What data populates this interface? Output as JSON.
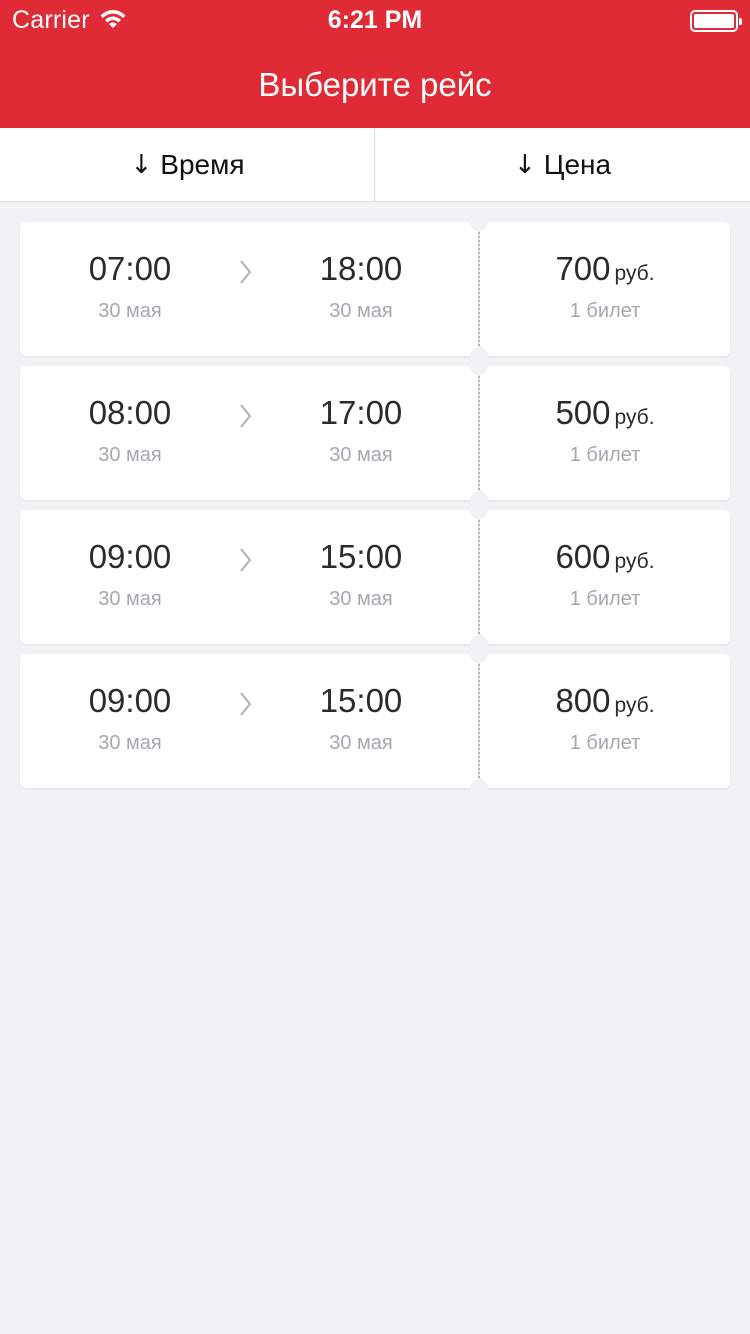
{
  "status_bar": {
    "carrier": "Carrier",
    "time": "6:21 PM"
  },
  "header": {
    "title": "Выберите рейс",
    "color": "#e02b36"
  },
  "sort": {
    "time_label": "Время",
    "price_label": "Цена",
    "arrow_icon": "arrow-down-icon"
  },
  "trips": [
    {
      "dep_time": "07:00",
      "dep_date": "30 мая",
      "arr_time": "18:00",
      "arr_date": "30 мая",
      "price": "700",
      "currency": "руб.",
      "tickets": "1 билет"
    },
    {
      "dep_time": "08:00",
      "dep_date": "30 мая",
      "arr_time": "17:00",
      "arr_date": "30 мая",
      "price": "500",
      "currency": "руб.",
      "tickets": "1 билет"
    },
    {
      "dep_time": "09:00",
      "dep_date": "30 мая",
      "arr_time": "15:00",
      "arr_date": "30 мая",
      "price": "600",
      "currency": "руб.",
      "tickets": "1 билет"
    },
    {
      "dep_time": "09:00",
      "dep_date": "30 мая",
      "arr_time": "15:00",
      "arr_date": "30 мая",
      "price": "800",
      "currency": "руб.",
      "tickets": "1 билет"
    }
  ]
}
